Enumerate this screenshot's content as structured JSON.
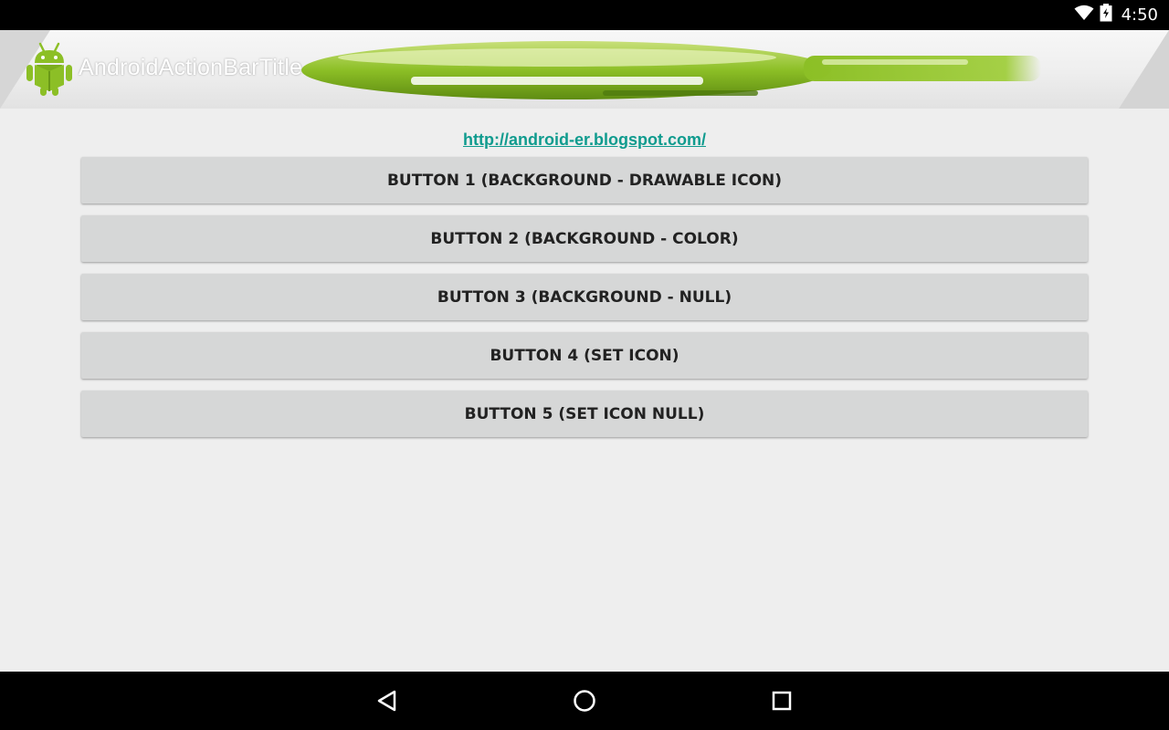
{
  "status_bar": {
    "time": "4:50",
    "icons": [
      "wifi-icon",
      "battery-charging-icon"
    ]
  },
  "action_bar": {
    "title": "AndroidActionBarTitle",
    "icon": "android-robot-icon",
    "colors": {
      "title": "#ffffff",
      "banner_green": "#8cbf26"
    }
  },
  "content": {
    "link_text": "http://android-er.blogspot.com/",
    "link_color": "#0f9b8e",
    "buttons": [
      {
        "label": "BUTTON 1 (BACKGROUND - DRAWABLE ICON)"
      },
      {
        "label": "BUTTON 2 (BACKGROUND - COLOR)"
      },
      {
        "label": "BUTTON 3 (BACKGROUND - NULL)"
      },
      {
        "label": "BUTTON 4 (SET ICON)"
      },
      {
        "label": "BUTTON 5 (SET ICON NULL)"
      }
    ]
  },
  "nav_bar": {
    "buttons": [
      "back-icon",
      "home-icon",
      "recents-icon"
    ]
  }
}
